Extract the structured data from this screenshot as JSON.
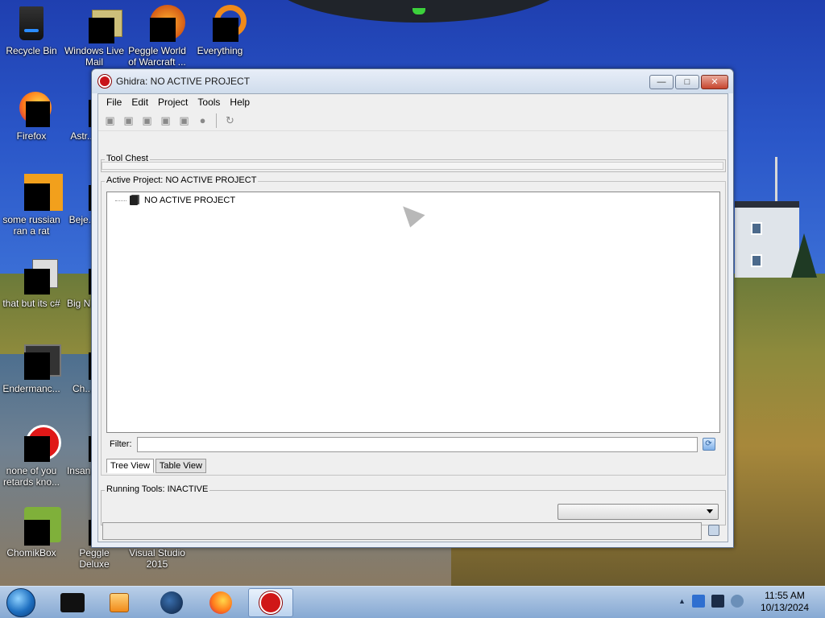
{
  "desktop": {
    "icons": [
      {
        "label": "Recycle Bin"
      },
      {
        "label": "Windows Live Mail"
      },
      {
        "label": "Peggle World of Warcraft ..."
      },
      {
        "label": "Everything"
      },
      {
        "label": "Firefox"
      },
      {
        "label": "Astr... De..."
      },
      {
        "label": "some russian ran a rat"
      },
      {
        "label": "Beje... De..."
      },
      {
        "label": "that but its c#"
      },
      {
        "label": "Big N... De..."
      },
      {
        "label": "Endermanc..."
      },
      {
        "label": "Ch... De..."
      },
      {
        "label": "none of you retards kno..."
      },
      {
        "label": "Insan... De..."
      },
      {
        "label": "ChomikBox"
      },
      {
        "label": "Peggle Deluxe"
      },
      {
        "label": "Visual Studio 2015"
      }
    ]
  },
  "window": {
    "title": "Ghidra: NO ACTIVE PROJECT",
    "controls": {
      "minimize": "—",
      "maximize": "□",
      "close": "✕"
    },
    "menu": [
      "File",
      "Edit",
      "Project",
      "Tools",
      "Help"
    ],
    "toolbar_icons": [
      "new-project-icon",
      "open-project-icon",
      "close-project-icon",
      "save-project-icon",
      "delete-project-icon",
      "archive-icon",
      "refresh-icon"
    ],
    "tool_chest_label": "Tool Chest",
    "active_project_label": "Active Project: NO ACTIVE PROJECT",
    "tree_root": "NO ACTIVE PROJECT",
    "filter_label": "Filter:",
    "filter_value": "",
    "tabs": [
      "Tree View",
      "Table View"
    ],
    "selected_tab": "Tree View",
    "running_tools_label": "Running Tools: INACTIVE",
    "running_tools_select": ""
  },
  "taskbar": {
    "time": "11:55 AM",
    "date": "10/13/2024"
  },
  "colors": {
    "ghidra_red": "#c8141a",
    "titlebar": "#cfdcec",
    "taskbar": "#9fbbdd"
  }
}
